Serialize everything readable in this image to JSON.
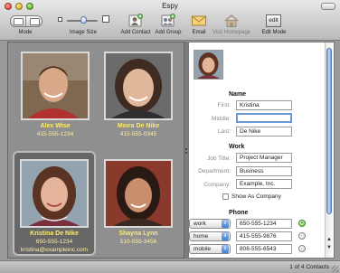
{
  "window": {
    "title": "Espy"
  },
  "toolbar": {
    "mode_label": "Mode",
    "image_size_label": "Image Size",
    "add_contact_label": "Add Contact",
    "add_group_label": "Add Group",
    "email_label": "Email",
    "visit_homepage_label": "Visit Homepage",
    "edit_mode_label": "Edit Mode",
    "edit_icon_text": "edit",
    "image_size_level": 0.55
  },
  "contacts": [
    {
      "name": "Alex Wise",
      "phone": "415-555-1234",
      "email": ""
    },
    {
      "name": "Moira De Nike",
      "phone": "415-555-0345",
      "email": ""
    },
    {
      "name": "Kristina De Nike",
      "phone": "650-555-1234",
      "email": "kristina@exampleinc.com"
    },
    {
      "name": "Shayna Lynn",
      "phone": "510-555-3456",
      "email": ""
    }
  ],
  "detail": {
    "name_heading": "Name",
    "first_label": "First:",
    "first_value": "Kristina",
    "middle_label": "Middle:",
    "middle_value": "",
    "last_label": "Last:",
    "last_value": "De Nike",
    "work_heading": "Work",
    "job_title_label": "Job Title:",
    "job_title_value": "Project Manager",
    "department_label": "Department:",
    "department_value": "Business",
    "company_label": "Company:",
    "company_value": "Example, Inc.",
    "show_as_company_label": "Show As Company",
    "phone_heading": "Phone",
    "phones": [
      {
        "type": "work",
        "number": "650-555-1234"
      },
      {
        "type": "home",
        "number": "415-555-9876"
      },
      {
        "type": "mobile",
        "number": "808-555-6543"
      }
    ]
  },
  "status": {
    "count_text": "1 of 4 Contacts"
  },
  "colors": {
    "name_yellow": "#ffec6a",
    "selection_blue": "#6b98d8"
  }
}
